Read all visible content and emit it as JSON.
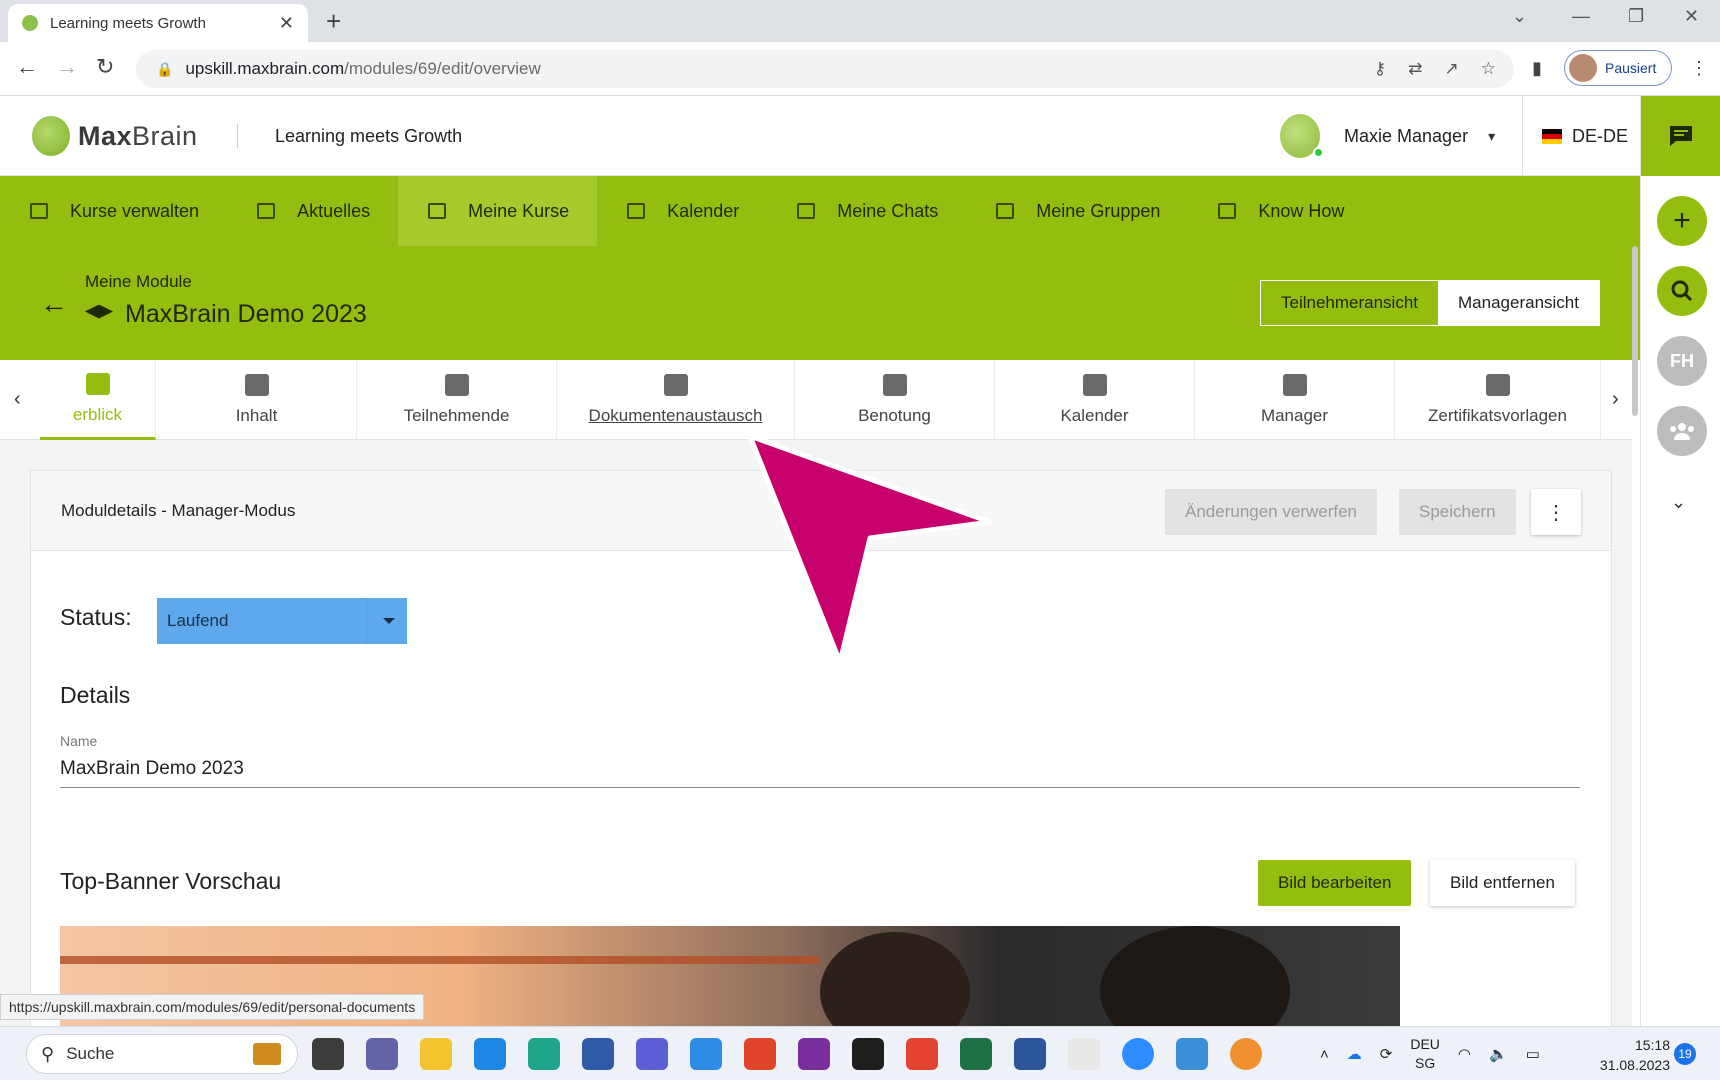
{
  "browser": {
    "tab_title": "Learning meets Growth",
    "tab_close": "✕",
    "new_tab": "+",
    "url_host": "upskill.maxbrain.com",
    "url_path": "/modules/69/edit/overview",
    "profile_label": "Pausiert",
    "window_controls": {
      "chevron": "⌄",
      "minimize": "—",
      "restore": "❐",
      "close": "✕"
    },
    "nav": {
      "back": "←",
      "forward": "→",
      "reload": "↻"
    },
    "kebab": "⋮",
    "status_url": "https://upskill.maxbrain.com/modules/69/edit/personal-documents"
  },
  "header": {
    "logo_bold": "Max",
    "logo_light": "Brain",
    "tagline": "Learning meets Growth",
    "user_name": "Maxie Manager",
    "language": "DE-DE"
  },
  "main_nav": {
    "items": [
      {
        "label": "Kurse verwalten",
        "icon": "id-card-icon",
        "active": false
      },
      {
        "label": "Aktuelles",
        "icon": "news-icon",
        "active": false
      },
      {
        "label": "Meine Kurse",
        "icon": "graduation-cap-icon",
        "active": true
      },
      {
        "label": "Kalender",
        "icon": "calendar-icon",
        "active": false
      },
      {
        "label": "Meine Chats",
        "icon": "chat-icon",
        "active": false
      },
      {
        "label": "Meine Gruppen",
        "icon": "group-card-icon",
        "active": false
      },
      {
        "label": "Know How",
        "icon": "book-icon",
        "active": false
      }
    ]
  },
  "module": {
    "breadcrumb": "Meine Module",
    "title": "MaxBrain Demo 2023",
    "view_participant": "Teilnehmeransicht",
    "view_manager": "Manageransicht"
  },
  "sub_tabs": [
    {
      "label": "erblick",
      "icon": "dashboard-icon",
      "active": true
    },
    {
      "label": "Inhalt",
      "icon": "folder-icon"
    },
    {
      "label": "Teilnehmende",
      "icon": "people-icon"
    },
    {
      "label": "Dokumentenaustausch",
      "icon": "person-document-icon",
      "hover": true
    },
    {
      "label": "Benotung",
      "icon": "grade-document-icon"
    },
    {
      "label": "Kalender",
      "icon": "calendar-icon"
    },
    {
      "label": "Manager",
      "icon": "manager-icon"
    },
    {
      "label": "Zertifikatsvorlagen",
      "icon": "certificate-settings-icon"
    }
  ],
  "card": {
    "title": "Moduldetails - Manager-Modus",
    "discard_label": "Änderungen verwerfen",
    "save_label": "Speichern",
    "status_label": "Status:",
    "status_value": "Laufend",
    "details_heading": "Details",
    "name_label": "Name",
    "name_value": "MaxBrain Demo 2023",
    "banner_heading": "Top-Banner Vorschau",
    "edit_image_label": "Bild bearbeiten",
    "remove_image_label": "Bild entfernen"
  },
  "rail": {
    "avatar_initials": "FH"
  },
  "taskbar": {
    "search_label": "Suche",
    "lang_line1": "DEU",
    "lang_line2": "SG",
    "time": "15:18",
    "date": "31.08.2023",
    "notification_count": "19"
  },
  "colors": {
    "brand_green": "#95bd0f",
    "status_blue": "#5ea9ee",
    "pointer_magenta": "#c8006b"
  }
}
